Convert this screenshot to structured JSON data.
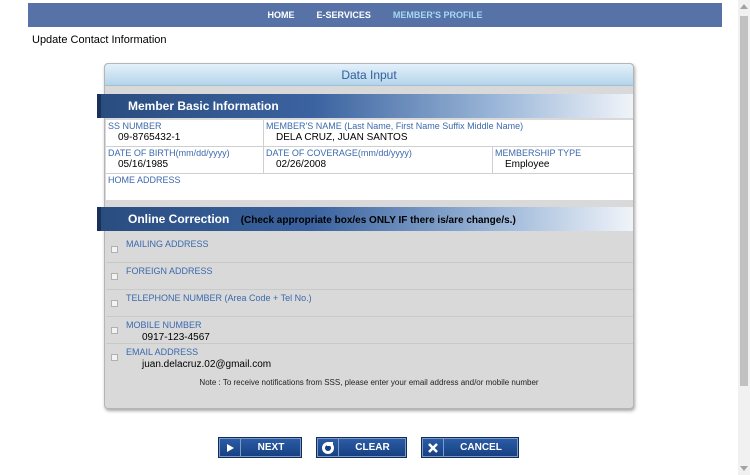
{
  "nav": {
    "items": [
      "HOME",
      "E-SERVICES",
      "MEMBER'S PROFILE"
    ]
  },
  "page_title": "Update Contact Information",
  "panel": {
    "header": "Data Input",
    "basic_title": "Member Basic Information",
    "fields": {
      "ss_number_label": "SS NUMBER",
      "ss_number": "09-8765432-1",
      "name_label": "MEMBER'S NAME  (Last Name, First Name Suffix Middle Name)",
      "name": "DELA CRUZ, JUAN SANTOS",
      "dob_label": "DATE OF BIRTH(mm/dd/yyyy)",
      "dob": "05/16/1985",
      "coverage_label": "DATE OF COVERAGE(mm/dd/yyyy)",
      "coverage": "02/26/2008",
      "membership_label": "MEMBERSHIP TYPE",
      "membership": "Employee",
      "address_label": "HOME ADDRESS",
      "address": ""
    },
    "correction_title": "Online Correction",
    "correction_hint": "(Check appropriate box/es ONLY IF there is/are change/s.)",
    "corrections": [
      {
        "label": "MAILING ADDRESS",
        "value": ""
      },
      {
        "label": "FOREIGN ADDRESS",
        "value": ""
      },
      {
        "label": "TELEPHONE NUMBER (Area Code + Tel No.)",
        "value": ""
      },
      {
        "label": "MOBILE NUMBER",
        "value": "0917-123-4567"
      },
      {
        "label": "EMAIL ADDRESS",
        "value": "juan.delacruz.02@gmail.com"
      }
    ],
    "note": "Note : To receive notifications from SSS, please enter your email address and/or mobile number"
  },
  "buttons": {
    "next": "NEXT",
    "clear": "CLEAR",
    "cancel": "CANCEL"
  }
}
